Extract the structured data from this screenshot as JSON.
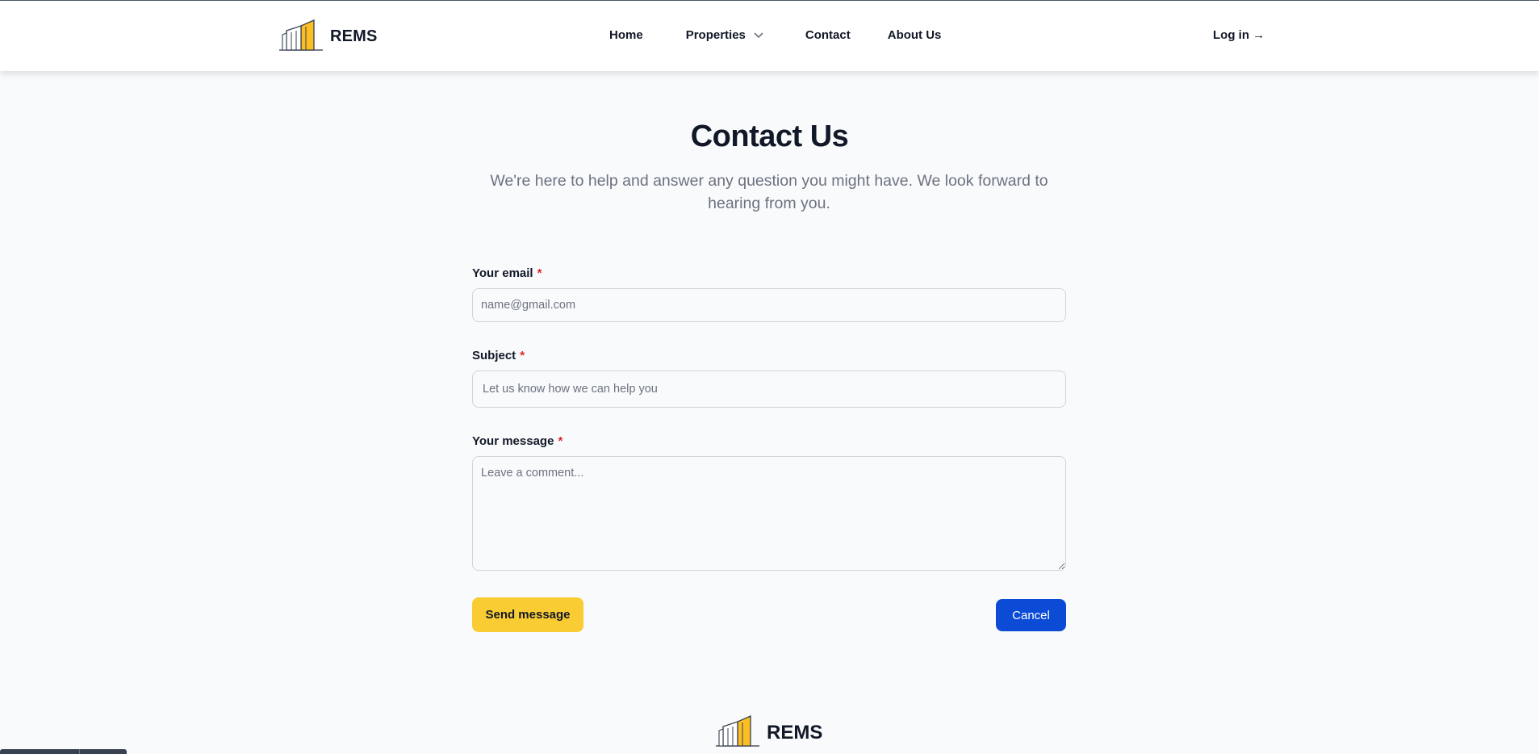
{
  "brand": {
    "name": "REMS",
    "logo_icon": "building-logo-icon",
    "accent_color": "#fbbf24"
  },
  "nav": {
    "items": [
      {
        "label": "Home"
      },
      {
        "label": "Properties",
        "icon": "chevron-down-icon"
      },
      {
        "label": "Contact"
      },
      {
        "label": "About Us"
      }
    ],
    "login_label": "Log in →"
  },
  "page": {
    "title": "Contact Us",
    "subtitle": "We're here to help and answer any question you might have. We look forward to hearing from you."
  },
  "form": {
    "email": {
      "label": "Your email",
      "required_mark": "*",
      "placeholder": "name@gmail.com",
      "value": ""
    },
    "subject": {
      "label": "Subject",
      "required_mark": "*",
      "placeholder": "Let us know how we can help you",
      "value": ""
    },
    "message": {
      "label": "Your message",
      "required_mark": "*",
      "placeholder": "Leave a comment...",
      "value": ""
    },
    "send_label": "Send message",
    "cancel_label": "Cancel"
  },
  "footer": {
    "brand_name": "REMS"
  },
  "colors": {
    "send_button": "#facc33",
    "cancel_button": "#0b4bd6",
    "required": "#dc2626"
  }
}
